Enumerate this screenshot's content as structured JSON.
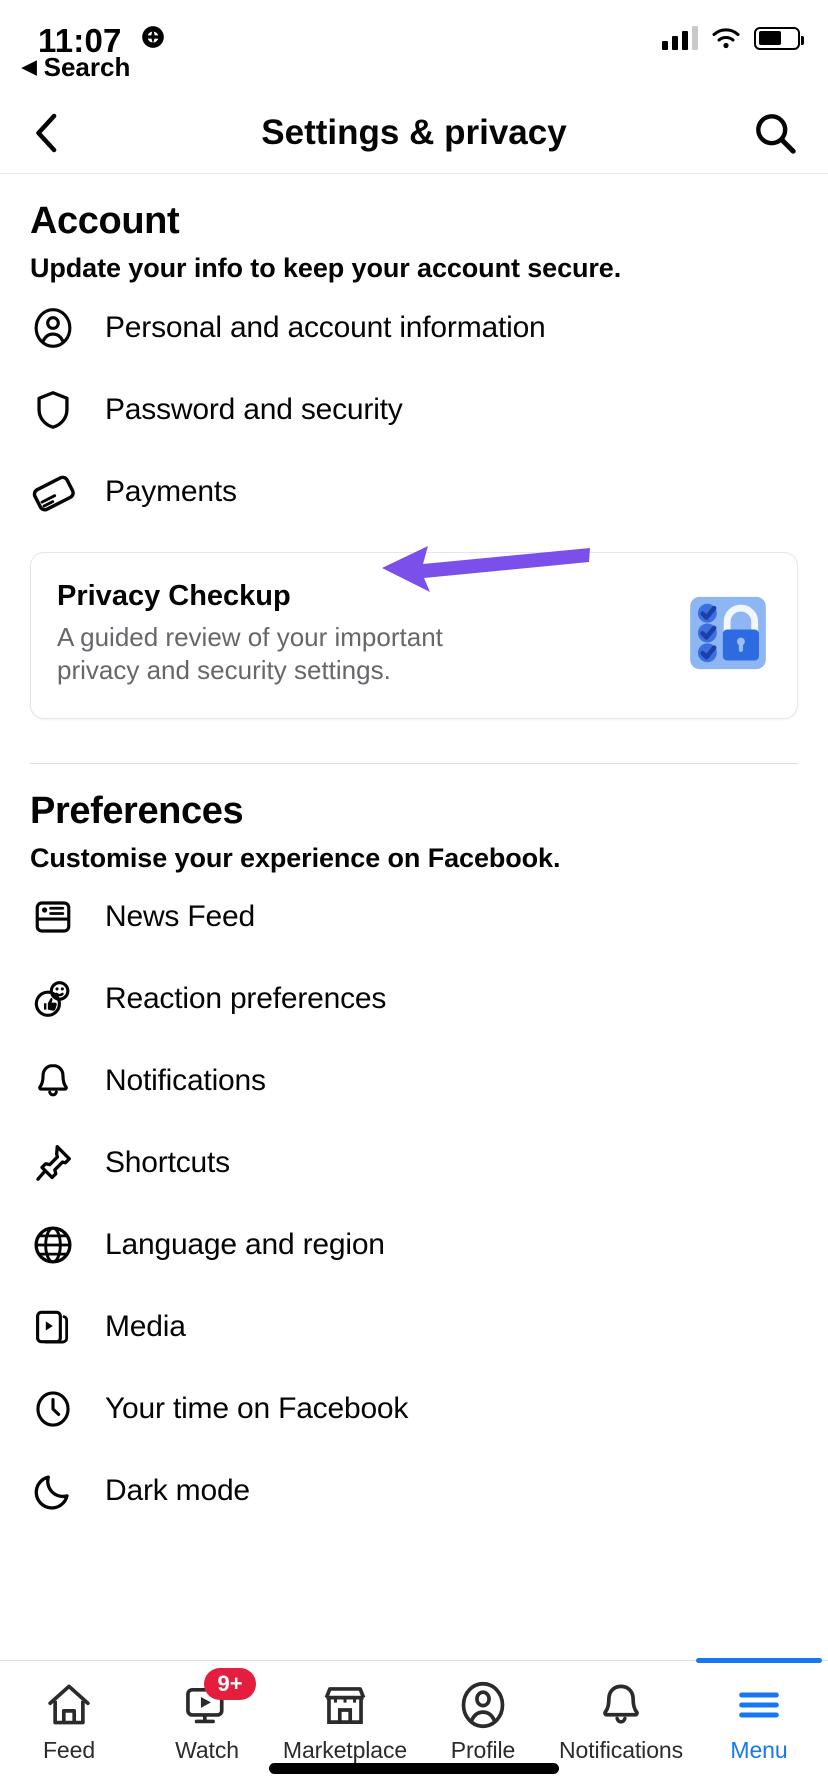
{
  "status_bar": {
    "time": "11:07",
    "location_icon": "location-arrow-globe-icon",
    "back_to_app_label": "Search",
    "signal_icon": "cellular-signal-icon",
    "wifi_icon": "wifi-icon",
    "battery_icon": "battery-icon"
  },
  "header": {
    "back_icon": "chevron-left-icon",
    "title": "Settings & privacy",
    "search_icon": "search-icon"
  },
  "account": {
    "title": "Account",
    "subtitle": "Update your info to keep your account secure.",
    "items": [
      {
        "label": "Personal and account information",
        "icon": "person-circle-icon"
      },
      {
        "label": "Password and security",
        "icon": "shield-icon"
      },
      {
        "label": "Payments",
        "icon": "credit-card-icon"
      }
    ]
  },
  "privacy_checkup": {
    "title": "Privacy Checkup",
    "description": "A guided review of your important privacy and security settings.",
    "illustration": "checklist-padlock-icon"
  },
  "preferences": {
    "title": "Preferences",
    "subtitle": "Customise your experience on Facebook.",
    "items": [
      {
        "label": "News Feed",
        "icon": "news-feed-icon"
      },
      {
        "label": "Reaction preferences",
        "icon": "reactions-icon"
      },
      {
        "label": "Notifications",
        "icon": "bell-icon"
      },
      {
        "label": "Shortcuts",
        "icon": "pin-icon"
      },
      {
        "label": "Language and region",
        "icon": "globe-icon"
      },
      {
        "label": "Media",
        "icon": "media-icon"
      },
      {
        "label": "Your time on Facebook",
        "icon": "clock-icon"
      },
      {
        "label": "Dark mode",
        "icon": "moon-icon"
      }
    ]
  },
  "tab_bar": {
    "tabs": [
      {
        "label": "Feed",
        "icon": "home-icon",
        "active": false,
        "badge": ""
      },
      {
        "label": "Watch",
        "icon": "watch-play-icon",
        "active": false,
        "badge": "9+"
      },
      {
        "label": "Marketplace",
        "icon": "storefront-icon",
        "active": false,
        "badge": ""
      },
      {
        "label": "Profile",
        "icon": "person-circle-icon",
        "active": false,
        "badge": ""
      },
      {
        "label": "Notifications",
        "icon": "bell-icon",
        "active": false,
        "badge": ""
      },
      {
        "label": "Menu",
        "icon": "hamburger-menu-icon",
        "active": true,
        "badge": ""
      }
    ]
  },
  "annotation": {
    "arrow_color": "#7B4FEA",
    "points_to": "Password and security"
  },
  "colors": {
    "accent": "#1877f2",
    "badge": "#e41e3f",
    "text_primary": "#050505",
    "text_secondary": "#65676b",
    "annotation_purple": "#7B4FEA"
  }
}
